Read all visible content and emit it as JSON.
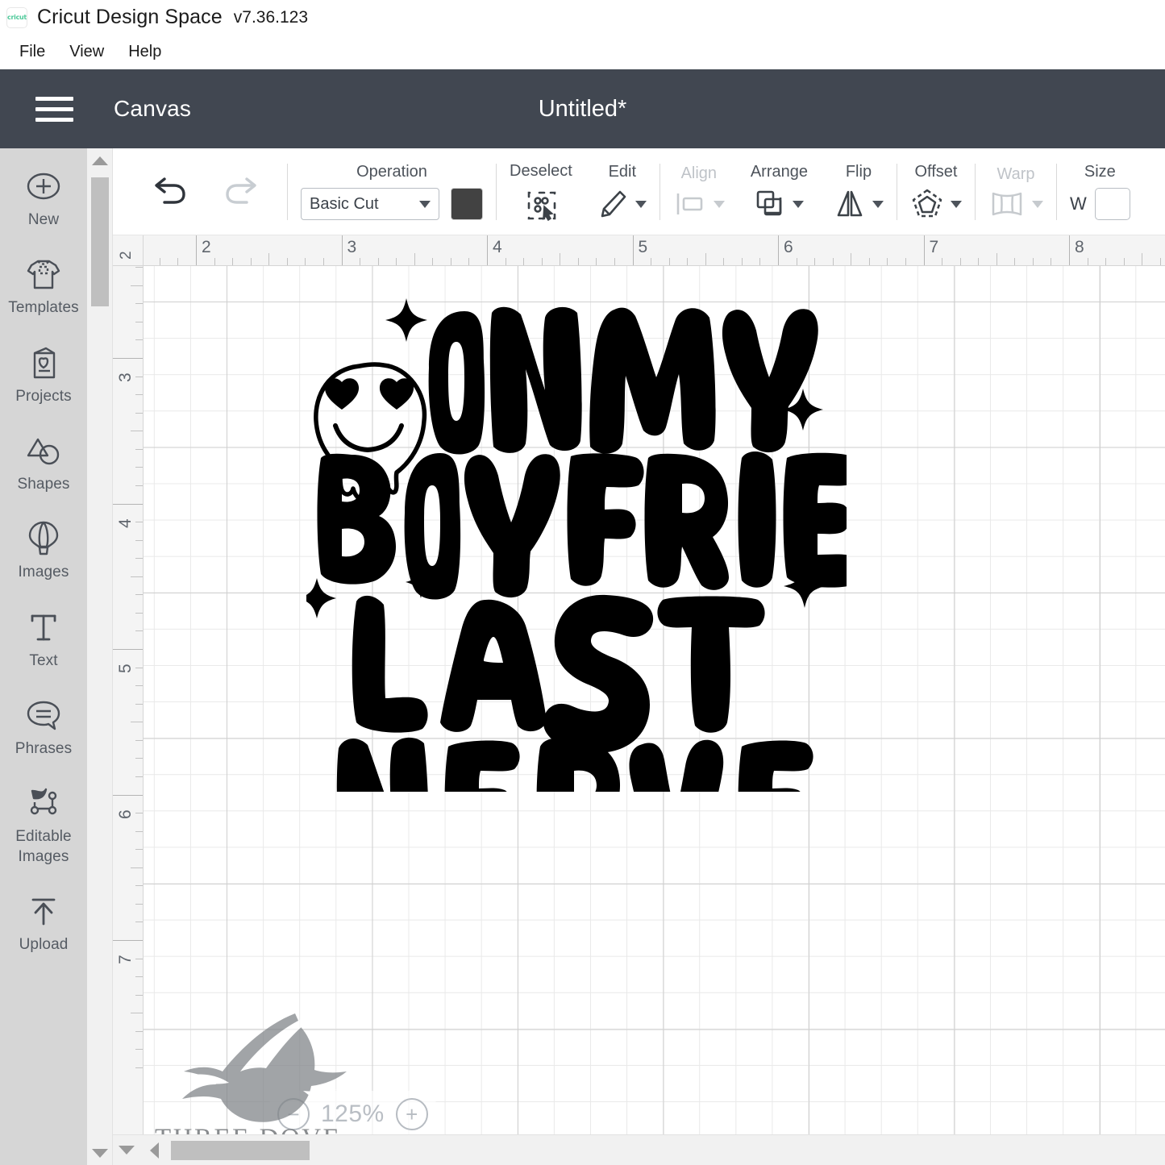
{
  "window": {
    "app_title": "Cricut Design Space",
    "app_version": "v7.36.123",
    "logo_text": "cricut"
  },
  "menubar": {
    "items": [
      "File",
      "View",
      "Help"
    ]
  },
  "header": {
    "canvas_label": "Canvas",
    "document_title": "Untitled*",
    "background": "#414751"
  },
  "sidebar": {
    "items": [
      {
        "label": "New",
        "icon": "plus-circle-icon"
      },
      {
        "label": "Templates",
        "icon": "tshirt-icon"
      },
      {
        "label": "Projects",
        "icon": "card-heart-icon"
      },
      {
        "label": "Shapes",
        "icon": "shapes-icon"
      },
      {
        "label": "Images",
        "icon": "hot-air-balloon-icon"
      },
      {
        "label": "Text",
        "icon": "text-t-icon"
      },
      {
        "label": "Phrases",
        "icon": "speech-bubble-icon"
      },
      {
        "label": "Editable Images",
        "icon": "editable-path-icon"
      },
      {
        "label": "Upload",
        "icon": "upload-arrow-icon"
      }
    ]
  },
  "toolbar": {
    "undo_label": "Undo",
    "redo_label": "Redo",
    "operation": {
      "label": "Operation",
      "selected": "Basic Cut",
      "color": "#424242"
    },
    "groups": [
      {
        "label": "Deselect",
        "icon": "deselect-icon",
        "disabled": false,
        "caret": false
      },
      {
        "label": "Edit",
        "icon": "pencil-icon",
        "disabled": false,
        "caret": true
      },
      {
        "label": "Align",
        "icon": "align-icon",
        "disabled": true,
        "caret": true
      },
      {
        "label": "Arrange",
        "icon": "arrange-icon",
        "disabled": false,
        "caret": true
      },
      {
        "label": "Flip",
        "icon": "flip-icon",
        "disabled": false,
        "caret": true
      },
      {
        "label": "Offset",
        "icon": "offset-icon",
        "disabled": false,
        "caret": true
      },
      {
        "label": "Warp",
        "icon": "warp-icon",
        "disabled": true,
        "caret": true
      },
      {
        "label": "Size",
        "icon": "size-icon",
        "disabled": false,
        "caret": false
      }
    ],
    "size": {
      "label": "Size",
      "width_label": "W",
      "width_value": ""
    }
  },
  "canvas": {
    "ruler_h_labels": [
      "2",
      "3",
      "4",
      "5",
      "6",
      "7",
      "8"
    ],
    "ruler_v_labels": [
      "3",
      "4",
      "5",
      "6",
      "7"
    ],
    "ruler_corner_label": "2",
    "zoom": {
      "value": "125%",
      "minus_label": "−",
      "plus_label": "+"
    },
    "artwork": {
      "text_lines": [
        "ON MY",
        "BOYFRIEND'S",
        "LAST",
        "NERVE"
      ],
      "fill_color": "#000000",
      "decorations": [
        "melting-smiley-heart-eyes",
        "sparkle-star",
        "sparkle-star",
        "sparkle-star",
        "sparkle-star",
        "sparkle-star"
      ]
    }
  },
  "watermark": {
    "text": "THREE DOVE",
    "icon": "dove-icon"
  }
}
